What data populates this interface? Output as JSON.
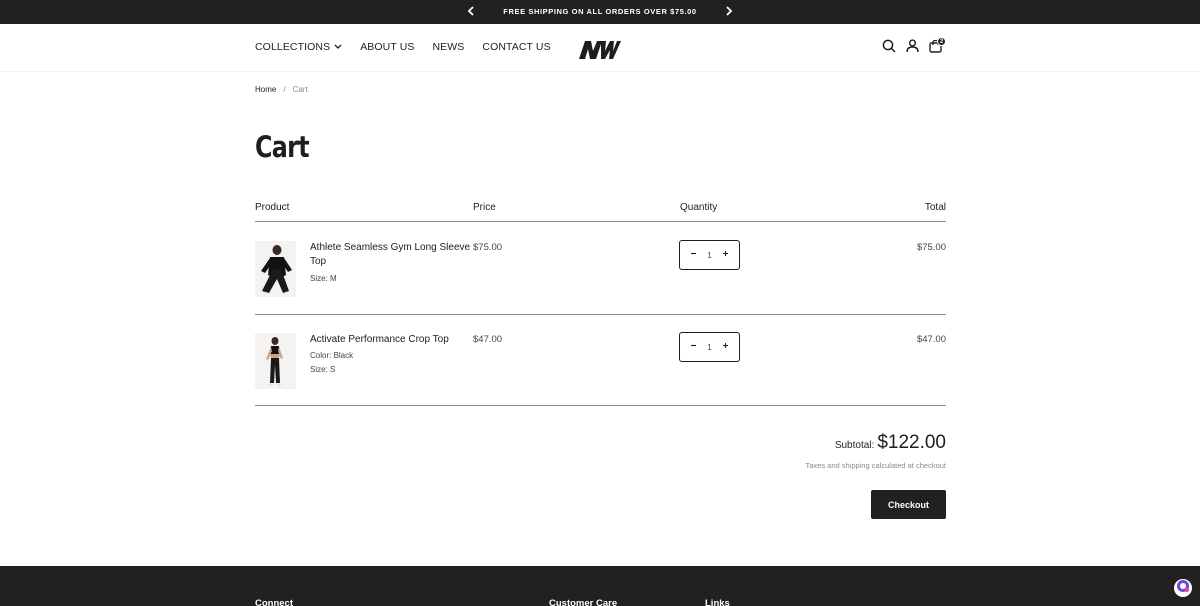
{
  "announcement": {
    "message": "FREE SHIPPING ON ALL ORDERS OVER $75.00"
  },
  "header": {
    "nav": [
      {
        "label": "COLLECTIONS",
        "has_dropdown": true
      },
      {
        "label": "ABOUT US"
      },
      {
        "label": "NEWS"
      },
      {
        "label": "CONTACT US"
      }
    ],
    "cart_count": "2"
  },
  "breadcrumb": {
    "home": "Home",
    "separator": "/",
    "current": "Cart"
  },
  "page_title": "Cart",
  "table": {
    "headers": {
      "product": "Product",
      "price": "Price",
      "quantity": "Quantity",
      "total": "Total"
    },
    "items": [
      {
        "name": "Athlete Seamless Gym Long Sleeve Top",
        "variants": [
          "Size: M"
        ],
        "price": "$75.00",
        "quantity": "1",
        "total": "$75.00"
      },
      {
        "name": "Activate Performance Crop Top",
        "variants": [
          "Color: Black",
          "Size: S"
        ],
        "price": "$47.00",
        "quantity": "1",
        "total": "$47.00"
      }
    ]
  },
  "summary": {
    "subtotal_label": "Subtotal:",
    "subtotal_value": "$122.00",
    "tax_note": "Taxes and shipping calculated at checkout",
    "checkout_label": "Checkout"
  },
  "footer": {
    "headings": [
      "Connect",
      "Customer Care",
      "Links"
    ]
  },
  "colors": {
    "dark": "#232120",
    "text": "#1e1e1e",
    "muted": "#8a8a8a",
    "divider": "#8c8c8c"
  },
  "icons": [
    "chevron-left-icon",
    "chevron-right-icon",
    "chevron-down-icon",
    "search-icon",
    "account-icon",
    "cart-icon",
    "minus-icon",
    "plus-icon",
    "chat-icon"
  ]
}
